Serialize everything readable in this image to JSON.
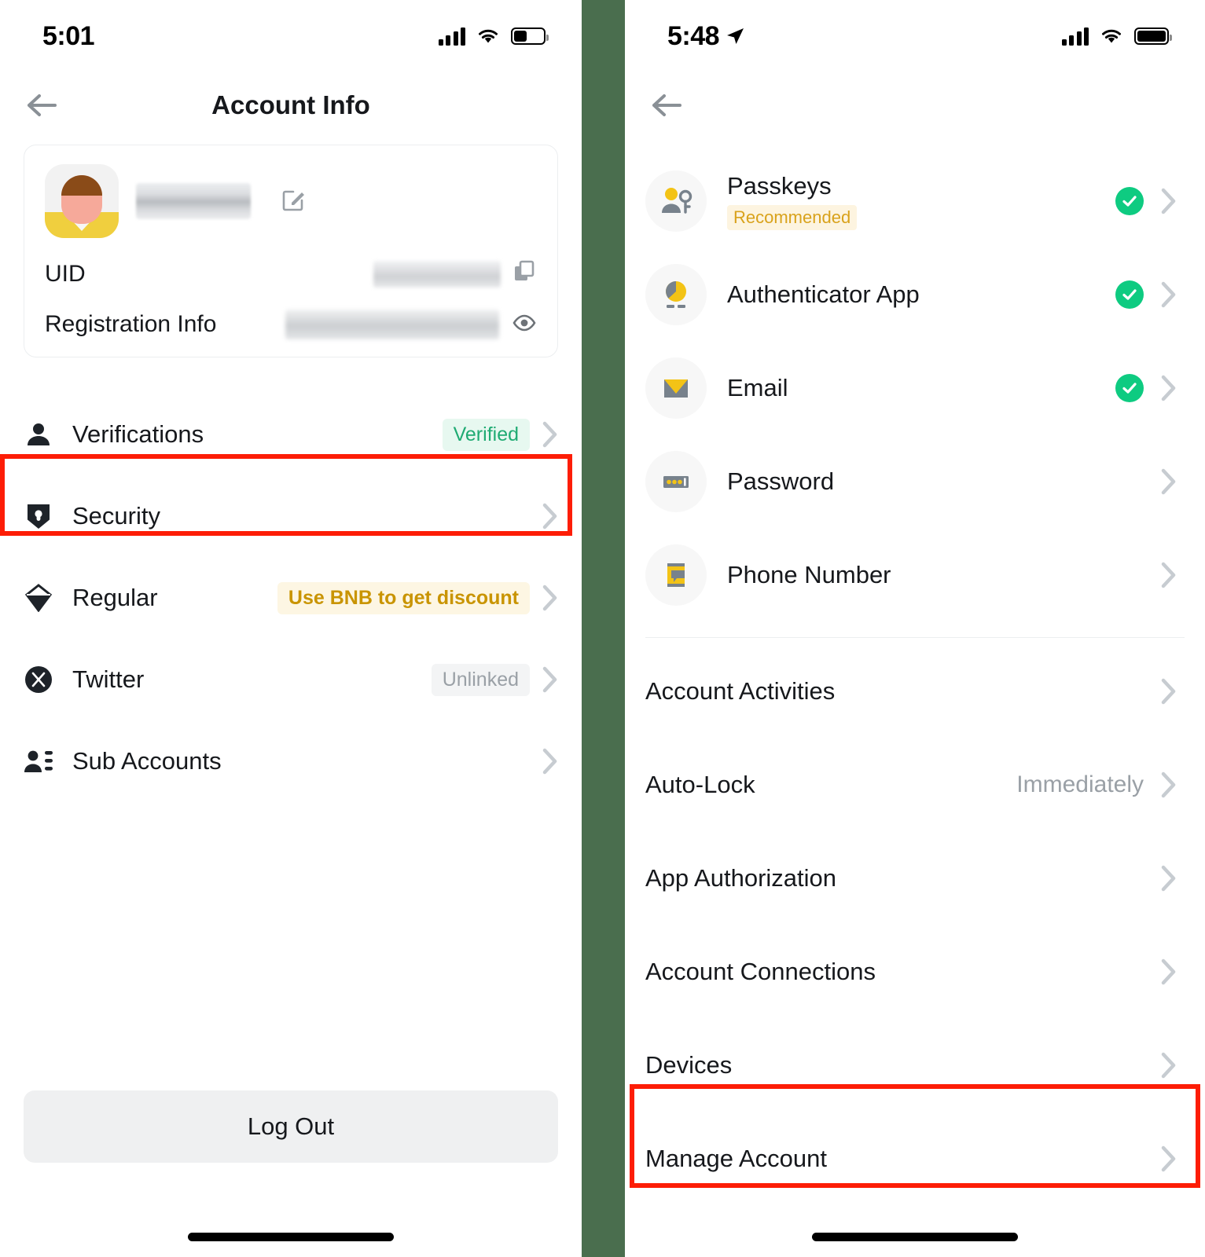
{
  "left": {
    "statusbar": {
      "time": "5:01",
      "signal_icon": "cellular-bars-icon",
      "wifi_icon": "wifi-icon",
      "battery_icon": "battery-low-icon"
    },
    "nav": {
      "back_icon": "back-arrow-icon",
      "title": "Account Info"
    },
    "profile": {
      "avatar_name": "user-avatar",
      "username_masked": "",
      "edit_icon": "edit-pencil-icon",
      "rows": [
        {
          "label": "UID",
          "value_masked": "",
          "action_icon": "copy-icon"
        },
        {
          "label": "Registration Info",
          "value_masked": "",
          "action_icon": "eye-icon"
        }
      ]
    },
    "menu": [
      {
        "icon": "person-icon",
        "label": "Verifications",
        "badge": "Verified",
        "badge_style": "green"
      },
      {
        "icon": "shield-lock-icon",
        "label": "Security",
        "badge": "",
        "badge_style": "none",
        "highlighted": true
      },
      {
        "icon": "diamond-icon",
        "label": "Regular",
        "badge": "Use BNB to get discount",
        "badge_style": "amber"
      },
      {
        "icon": "twitter-x-icon",
        "label": "Twitter",
        "badge": "Unlinked",
        "badge_style": "grey"
      },
      {
        "icon": "sub-accounts-icon",
        "label": "Sub Accounts",
        "badge": "",
        "badge_style": "none"
      }
    ],
    "logout_label": "Log Out"
  },
  "right": {
    "statusbar": {
      "time": "5:48",
      "location_icon": "location-arrow-icon",
      "signal_icon": "cellular-bars-icon",
      "wifi_icon": "wifi-icon",
      "battery_icon": "battery-full-icon"
    },
    "nav": {
      "back_icon": "back-arrow-icon",
      "title": ""
    },
    "security_items": [
      {
        "icon": "passkey-person-icon",
        "label": "Passkeys",
        "sublabel": "Recommended",
        "verified": true
      },
      {
        "icon": "authenticator-pie-icon",
        "label": "Authenticator App",
        "sublabel": "",
        "verified": true
      },
      {
        "icon": "email-envelope-icon",
        "label": "Email",
        "sublabel": "",
        "verified": true
      },
      {
        "icon": "password-dots-icon",
        "label": "Password",
        "sublabel": "",
        "verified": false
      },
      {
        "icon": "phone-number-icon",
        "label": "Phone Number",
        "sublabel": "",
        "verified": false
      }
    ],
    "plain_items": [
      {
        "label": "Account Activities",
        "value": ""
      },
      {
        "label": "Auto-Lock",
        "value": "Immediately"
      },
      {
        "label": "App Authorization",
        "value": ""
      },
      {
        "label": "Account Connections",
        "value": ""
      },
      {
        "label": "Devices",
        "value": ""
      },
      {
        "label": "Manage Account",
        "value": "",
        "highlighted": true
      }
    ]
  },
  "colors": {
    "highlight_box": "#fd1d06",
    "divider_green": "#4a6e4e",
    "verified_green": "#0ecb81",
    "badge_green_text": "#1fab73",
    "badge_amber_text": "#c99400",
    "accent_yellow": "#f0b90b"
  }
}
